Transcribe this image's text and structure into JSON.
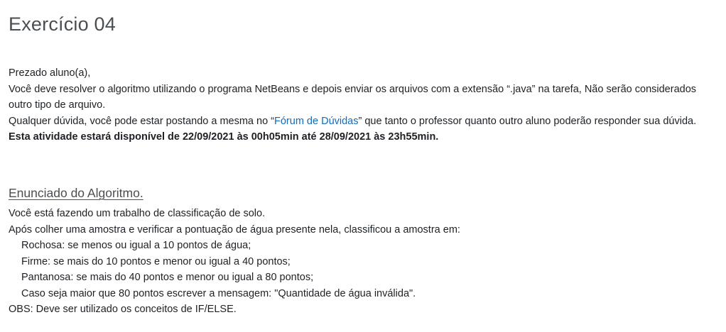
{
  "title": "Exercício 04",
  "intro": {
    "greeting": "Prezado aluno(a),",
    "instructions": "Você deve resolver o algoritmo utilizando o programa NetBeans e depois enviar os arquivos com a extensão “.java” na tarefa, Não serão considerados outro tipo de arquivo.",
    "forum_before": "Qualquer dúvida, você pode estar postando a mesma no “",
    "forum_link": "Fórum de Dúvidas",
    "forum_after": "” que tanto o professor quanto outro aluno poderão responder sua dúvida.",
    "availability": "Esta atividade estará disponível de 22/09/2021 às 00h05min até 28/09/2021 às 23h55min."
  },
  "statement": {
    "heading": "Enunciado do Algoritmo.",
    "lines": [
      "Você está fazendo um trabalho de classificação de solo.",
      "Após colher uma amostra e verificar a pontuação de água presente nela, classificou a amostra em:"
    ],
    "rules": [
      "Rochosa: se menos ou igual a 10 pontos de água;",
      "Firme: se mais do 10 pontos e menor ou igual a 40 pontos;",
      "Pantanosa: se mais do 40 pontos e menor ou igual a 80 pontos;",
      "Caso seja maior que 80 pontos escrever a mensagem: \"Quantidade de água inválida\"."
    ],
    "note": "OBS: Deve ser utilizado os conceitos de IF/ELSE."
  }
}
